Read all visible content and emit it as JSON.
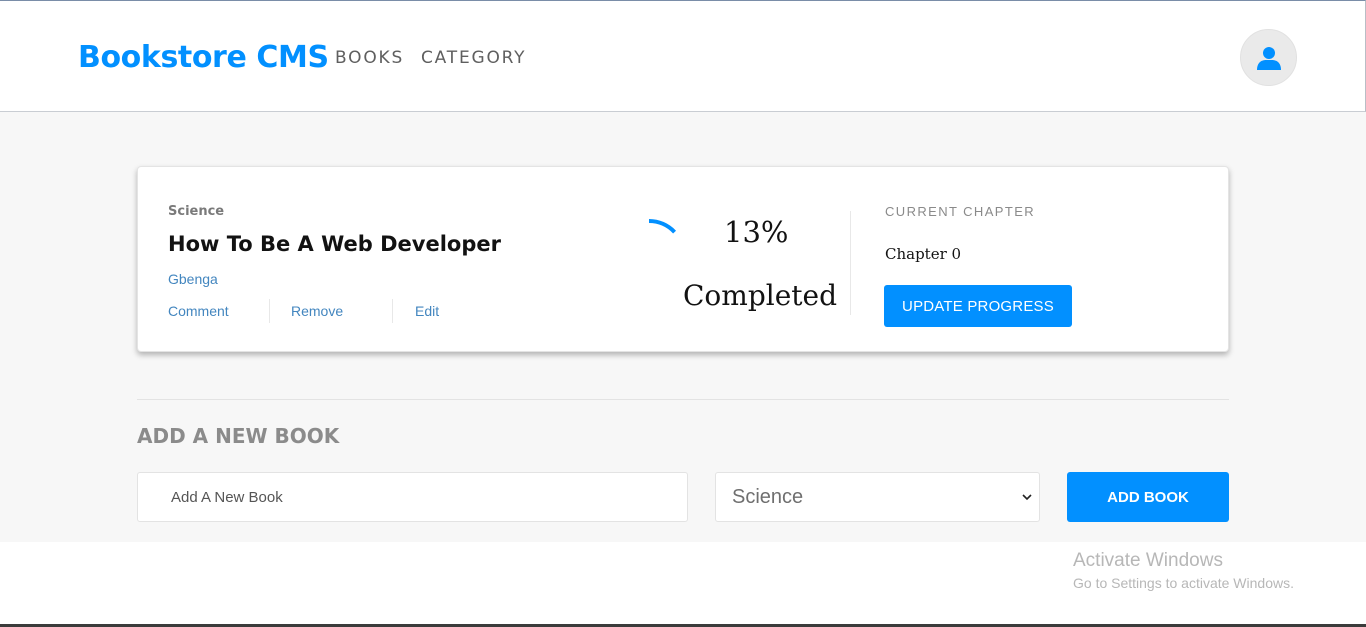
{
  "header": {
    "logo": "Bookstore CMS",
    "nav": [
      {
        "label": "BOOKS"
      },
      {
        "label": "CATEGORY"
      }
    ],
    "user_icon": "user-icon"
  },
  "book": {
    "category": "Science",
    "title": "How To Be A Web Developer",
    "author": "Gbenga",
    "actions": {
      "comment": "Comment",
      "remove": "Remove",
      "edit": "Edit"
    },
    "progress": {
      "percent_label": "13%",
      "percent_value": 13,
      "status": "Completed",
      "ring_color": "#0290ff"
    },
    "current_chapter_label": "CURRENT CHAPTER",
    "chapter": "Chapter 0",
    "update_button": "UPDATE PROGRESS"
  },
  "add_form": {
    "heading": "ADD A NEW BOOK",
    "title_placeholder": "Add A New Book",
    "category_selected": "Science",
    "submit_label": "ADD BOOK"
  },
  "watermark": {
    "title": "Activate Windows",
    "subtitle": "Go to Settings to activate Windows."
  },
  "colors": {
    "accent": "#0290ff",
    "link": "#4386bf",
    "background": "#f7f7f7"
  }
}
